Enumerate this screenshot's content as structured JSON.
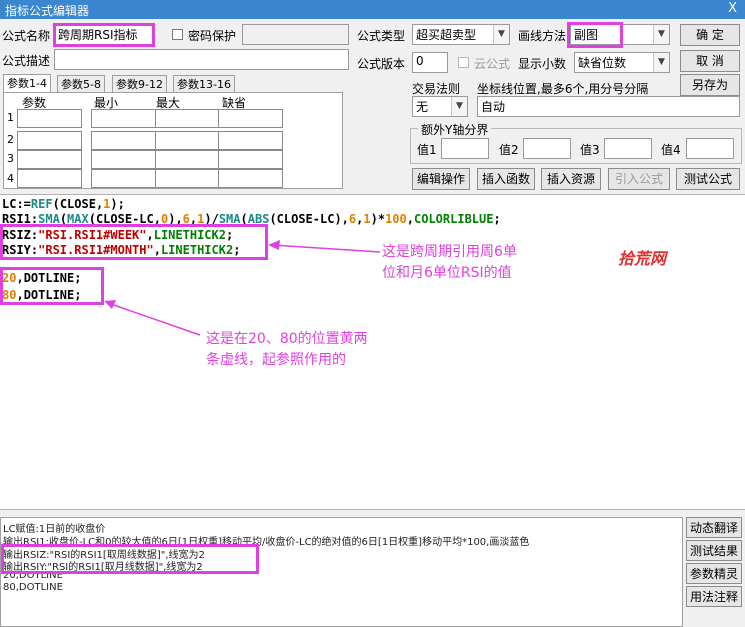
{
  "window": {
    "title": "指标公式编辑器",
    "close_glyph": "X"
  },
  "form": {
    "name_label": "公式名称",
    "name_value": "跨周期RSI指标",
    "password_label": "密码保护",
    "desc_label": "公式描述",
    "type_label": "公式类型",
    "type_value": "超买超卖型",
    "draw_label": "画线方法",
    "draw_value": "副图",
    "version_label": "公式版本",
    "version_value": "0",
    "cloud_label": "云公式",
    "decimal_label": "显示小数",
    "decimal_value": "缺省位数",
    "trade_label": "交易法则",
    "trade_value": "无",
    "coord_label": "坐标线位置,最多6个,用分号分隔",
    "coord_value": "自动",
    "extra_y_label": "额外Y轴分界",
    "val1": "值1",
    "val2": "值2",
    "val3": "值3",
    "val4": "值4"
  },
  "buttons": {
    "ok": "确  定",
    "cancel": "取  消",
    "save_as": "另存为",
    "edit_ops": "编辑操作",
    "insert_func": "插入函数",
    "insert_res": "插入资源",
    "import_formula": "引入公式",
    "test_formula": "测试公式"
  },
  "params": {
    "tabs": [
      "参数1-4",
      "参数5-8",
      "参数9-12",
      "参数13-16"
    ],
    "headers": [
      "参数",
      "最小",
      "最大",
      "缺省"
    ],
    "rows": [
      "1",
      "2",
      "3",
      "4"
    ]
  },
  "code": {
    "line1": {
      "a": "LC:=",
      "b": "REF",
      "c": "(CLOSE,",
      "d": "1",
      "e": ");"
    },
    "line2": {
      "a": "RSI1:",
      "b": "SMA",
      "c": "(",
      "d": "MAX",
      "e": "(CLOSE-LC,",
      "f": "0",
      "g": "),",
      "h": "6",
      "i": ",",
      "j": "1",
      "k": ")/",
      "l": "SMA",
      "m": "(",
      "n": "ABS",
      "o": "(CLOSE-LC),",
      "p": "6",
      "q": ",",
      "r": "1",
      "s": ")*",
      "t": "100",
      "u": ",",
      "v": "COLORLIBLUE",
      "w": ";"
    },
    "line3": {
      "a": "RSIZ:",
      "b": "\"RSI.RSI1#WEEK\"",
      "c": ",",
      "d": "LINETHICK2",
      "e": ";"
    },
    "line4": {
      "a": "RSIY:",
      "b": "\"RSI.RSI1#MONTH\"",
      "c": ",",
      "d": "LINETHICK2",
      "e": ";"
    },
    "line5": {
      "a": "20",
      "b": ",",
      "c": "DOTLINE",
      "d": ";"
    },
    "line6": {
      "a": "80",
      "b": ",",
      "c": "DOTLINE",
      "d": ";"
    }
  },
  "annotations": {
    "note1_line1": "这是跨周期引用周6单",
    "note1_line2": "位和月6单位RSI的值",
    "watermark": "拾荒网",
    "note2_line1": "这是在20、80的位置黄两",
    "note2_line2": "条虚线，起参照作用的"
  },
  "output": {
    "lines": [
      "LC赋值:1日前的收盘价",
      "输出RSI1:收盘价-LC和0的较大值的6日[1日权重]移动平均/收盘价-LC的绝对值的6日[1日权重]移动平均*100,画淡蓝色",
      "输出RSIZ:\"RSI的RSI1[取周线数据]\",线宽为2",
      "输出RSIY:\"RSI的RSI1[取月线数据]\",线宽为2",
      "20,DOTLINE",
      "80,DOTLINE"
    ]
  },
  "side": {
    "translate": "动态翻译",
    "test_result": "测试结果",
    "param_tune": "参数精灵",
    "usage": "用法注释"
  }
}
